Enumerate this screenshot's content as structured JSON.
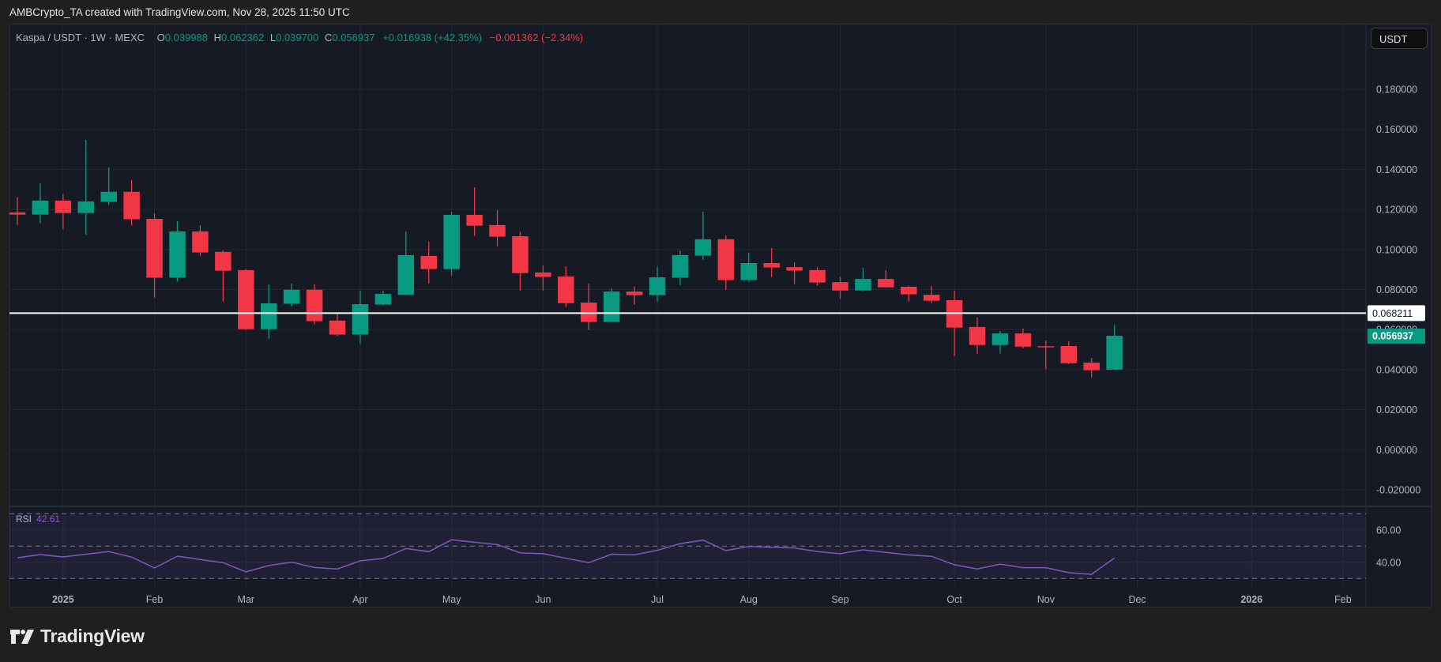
{
  "header": {
    "credit": "AMBCrypto_TA created with TradingView.com, Nov 28, 2025 11:50 UTC"
  },
  "legend": {
    "symbol": "Kaspa / USDT · 1W · MEXC",
    "open_label": "O",
    "open": "0.039988",
    "high_label": "H",
    "high": "0.062362",
    "low_label": "L",
    "low": "0.039700",
    "close_label": "C",
    "close": "0.056937",
    "change": "+0.016938 (+42.35%)",
    "change2": "−0.001362 (−2.34%)"
  },
  "currency_button": "USDT",
  "rsi": {
    "label": "RSI",
    "value": "42.61"
  },
  "logo": {
    "text": "TradingView"
  },
  "colors": {
    "up": "#089981",
    "down": "#f23645",
    "rsi": "#7e57c2",
    "background": "#161a25",
    "grid": "#232734"
  },
  "chart_data": {
    "type": "candlestick",
    "symbol": "Kaspa / USDT",
    "interval": "1W",
    "exchange": "MEXC",
    "ylim": [
      -0.03,
      0.19
    ],
    "grid": true,
    "price_ticks": [
      "0.180000",
      "0.160000",
      "0.140000",
      "0.120000",
      "0.100000",
      "0.080000",
      "0.060000",
      "0.040000",
      "0.020000",
      "0.000000",
      "-0.020000"
    ],
    "horizontal_line": {
      "value": 0.068211,
      "label": "0.068211"
    },
    "last_price": {
      "value": 0.056937,
      "label": "0.056937"
    },
    "time_labels": [
      {
        "label": "2025",
        "date": "2025-01-06",
        "bold": true
      },
      {
        "label": "Feb",
        "date": "2025-02-03"
      },
      {
        "label": "Mar",
        "date": "2025-03-03"
      },
      {
        "label": "Apr",
        "date": "2025-04-07"
      },
      {
        "label": "May",
        "date": "2025-05-05"
      },
      {
        "label": "Jun",
        "date": "2025-06-02"
      },
      {
        "label": "Jul",
        "date": "2025-07-07"
      },
      {
        "label": "Aug",
        "date": "2025-08-04"
      },
      {
        "label": "Sep",
        "date": "2025-09-01"
      },
      {
        "label": "Oct",
        "date": "2025-10-06"
      },
      {
        "label": "Nov",
        "date": "2025-11-03"
      },
      {
        "label": "Dec",
        "date": "2025-12-01"
      },
      {
        "label": "2026",
        "date": "2026-01-05",
        "bold": true
      },
      {
        "label": "Feb",
        "date": "2026-02-02"
      }
    ],
    "candles": [
      {
        "date": "2024-12-23",
        "o": 0.1185,
        "h": 0.126,
        "l": 0.1123,
        "c": 0.1174
      },
      {
        "date": "2024-12-30",
        "o": 0.1174,
        "h": 0.1331,
        "l": 0.1131,
        "c": 0.1244
      },
      {
        "date": "2025-01-06",
        "o": 0.1244,
        "h": 0.1276,
        "l": 0.1103,
        "c": 0.1182
      },
      {
        "date": "2025-01-13",
        "o": 0.1182,
        "h": 0.1548,
        "l": 0.1073,
        "c": 0.124
      },
      {
        "date": "2025-01-20",
        "o": 0.1238,
        "h": 0.141,
        "l": 0.1222,
        "c": 0.1288
      },
      {
        "date": "2025-01-27",
        "o": 0.1288,
        "h": 0.1347,
        "l": 0.1119,
        "c": 0.1151
      },
      {
        "date": "2025-02-03",
        "o": 0.1153,
        "h": 0.1181,
        "l": 0.076,
        "c": 0.0859
      },
      {
        "date": "2025-02-10",
        "o": 0.0859,
        "h": 0.1142,
        "l": 0.0839,
        "c": 0.109
      },
      {
        "date": "2025-02-17",
        "o": 0.109,
        "h": 0.1122,
        "l": 0.0969,
        "c": 0.0985
      },
      {
        "date": "2025-02-24",
        "o": 0.0988,
        "h": 0.0996,
        "l": 0.074,
        "c": 0.0894
      },
      {
        "date": "2025-03-03",
        "o": 0.0897,
        "h": 0.0901,
        "l": 0.0599,
        "c": 0.0602
      },
      {
        "date": "2025-03-10",
        "o": 0.0602,
        "h": 0.0826,
        "l": 0.0555,
        "c": 0.0731
      },
      {
        "date": "2025-03-17",
        "o": 0.0729,
        "h": 0.083,
        "l": 0.0716,
        "c": 0.0799
      },
      {
        "date": "2025-03-24",
        "o": 0.0799,
        "h": 0.0826,
        "l": 0.0626,
        "c": 0.0642
      },
      {
        "date": "2025-03-31",
        "o": 0.0645,
        "h": 0.0688,
        "l": 0.0567,
        "c": 0.0575
      },
      {
        "date": "2025-04-07",
        "o": 0.0575,
        "h": 0.0795,
        "l": 0.0528,
        "c": 0.0727
      },
      {
        "date": "2025-04-14",
        "o": 0.0725,
        "h": 0.0794,
        "l": 0.072,
        "c": 0.0778
      },
      {
        "date": "2025-04-21",
        "o": 0.0774,
        "h": 0.109,
        "l": 0.0772,
        "c": 0.0972
      },
      {
        "date": "2025-04-28",
        "o": 0.0968,
        "h": 0.1039,
        "l": 0.0831,
        "c": 0.0902
      },
      {
        "date": "2025-05-05",
        "o": 0.0902,
        "h": 0.1189,
        "l": 0.087,
        "c": 0.1173
      },
      {
        "date": "2025-05-12",
        "o": 0.1173,
        "h": 0.1311,
        "l": 0.1068,
        "c": 0.1119
      },
      {
        "date": "2025-05-19",
        "o": 0.1122,
        "h": 0.1197,
        "l": 0.1016,
        "c": 0.1064
      },
      {
        "date": "2025-05-26",
        "o": 0.1066,
        "h": 0.109,
        "l": 0.0795,
        "c": 0.0882
      },
      {
        "date": "2025-06-02",
        "o": 0.0885,
        "h": 0.092,
        "l": 0.0795,
        "c": 0.0863
      },
      {
        "date": "2025-06-09",
        "o": 0.0865,
        "h": 0.0916,
        "l": 0.0713,
        "c": 0.0732
      },
      {
        "date": "2025-06-16",
        "o": 0.0735,
        "h": 0.083,
        "l": 0.0598,
        "c": 0.0638
      },
      {
        "date": "2025-06-23",
        "o": 0.0638,
        "h": 0.0806,
        "l": 0.0638,
        "c": 0.079
      },
      {
        "date": "2025-06-30",
        "o": 0.079,
        "h": 0.0814,
        "l": 0.0724,
        "c": 0.0772
      },
      {
        "date": "2025-07-07",
        "o": 0.0772,
        "h": 0.0916,
        "l": 0.074,
        "c": 0.0861
      },
      {
        "date": "2025-07-14",
        "o": 0.0859,
        "h": 0.0995,
        "l": 0.0823,
        "c": 0.0972
      },
      {
        "date": "2025-07-21",
        "o": 0.0969,
        "h": 0.1189,
        "l": 0.0949,
        "c": 0.1051
      },
      {
        "date": "2025-07-28",
        "o": 0.1051,
        "h": 0.107,
        "l": 0.0799,
        "c": 0.0847
      },
      {
        "date": "2025-08-04",
        "o": 0.0847,
        "h": 0.0983,
        "l": 0.0839,
        "c": 0.0932
      },
      {
        "date": "2025-08-11",
        "o": 0.0932,
        "h": 0.1007,
        "l": 0.0862,
        "c": 0.091
      },
      {
        "date": "2025-08-18",
        "o": 0.0912,
        "h": 0.0936,
        "l": 0.0827,
        "c": 0.0894
      },
      {
        "date": "2025-08-25",
        "o": 0.0897,
        "h": 0.0912,
        "l": 0.0819,
        "c": 0.0835
      },
      {
        "date": "2025-09-01",
        "o": 0.0837,
        "h": 0.0865,
        "l": 0.0752,
        "c": 0.0795
      },
      {
        "date": "2025-09-08",
        "o": 0.0795,
        "h": 0.0908,
        "l": 0.0791,
        "c": 0.0853
      },
      {
        "date": "2025-09-15",
        "o": 0.0853,
        "h": 0.0897,
        "l": 0.0811,
        "c": 0.0811
      },
      {
        "date": "2025-09-22",
        "o": 0.0814,
        "h": 0.0818,
        "l": 0.074,
        "c": 0.0776
      },
      {
        "date": "2025-09-29",
        "o": 0.0774,
        "h": 0.0818,
        "l": 0.0732,
        "c": 0.0744
      },
      {
        "date": "2025-10-06",
        "o": 0.0747,
        "h": 0.0794,
        "l": 0.0468,
        "c": 0.061
      },
      {
        "date": "2025-10-13",
        "o": 0.0613,
        "h": 0.066,
        "l": 0.048,
        "c": 0.0523
      },
      {
        "date": "2025-10-20",
        "o": 0.0523,
        "h": 0.0593,
        "l": 0.048,
        "c": 0.0581
      },
      {
        "date": "2025-10-27",
        "o": 0.0581,
        "h": 0.0605,
        "l": 0.0507,
        "c": 0.0515
      },
      {
        "date": "2025-11-03",
        "o": 0.0517,
        "h": 0.0545,
        "l": 0.0401,
        "c": 0.0514
      },
      {
        "date": "2025-11-10",
        "o": 0.0518,
        "h": 0.0541,
        "l": 0.0428,
        "c": 0.0432
      },
      {
        "date": "2025-11-17",
        "o": 0.0435,
        "h": 0.0459,
        "l": 0.0361,
        "c": 0.0397
      },
      {
        "date": "2025-11-24",
        "o": 0.039988,
        "h": 0.062362,
        "l": 0.0397,
        "c": 0.056937
      }
    ],
    "rsi_pane": {
      "name": "RSI",
      "ylim": [
        25,
        75
      ],
      "ticks": [
        "60.00",
        "40.00"
      ],
      "bands": [
        70,
        50,
        30
      ],
      "values": [
        42.8,
        44.8,
        43.3,
        45.0,
        46.6,
        43.2,
        36.5,
        43.8,
        41.7,
        39.8,
        34.1,
        38.0,
        40.1,
        36.8,
        35.9,
        40.9,
        42.4,
        48.5,
        46.6,
        53.9,
        52.4,
        51.0,
        45.8,
        45.3,
        42.5,
        39.8,
        45.0,
        44.6,
        47.4,
        51.5,
        53.7,
        47.2,
        49.8,
        49.3,
        48.9,
        46.6,
        45.3,
        47.7,
        46.1,
        44.6,
        43.7,
        38.5,
        35.9,
        38.9,
        36.7,
        36.7,
        33.6,
        32.6,
        42.61
      ]
    }
  }
}
